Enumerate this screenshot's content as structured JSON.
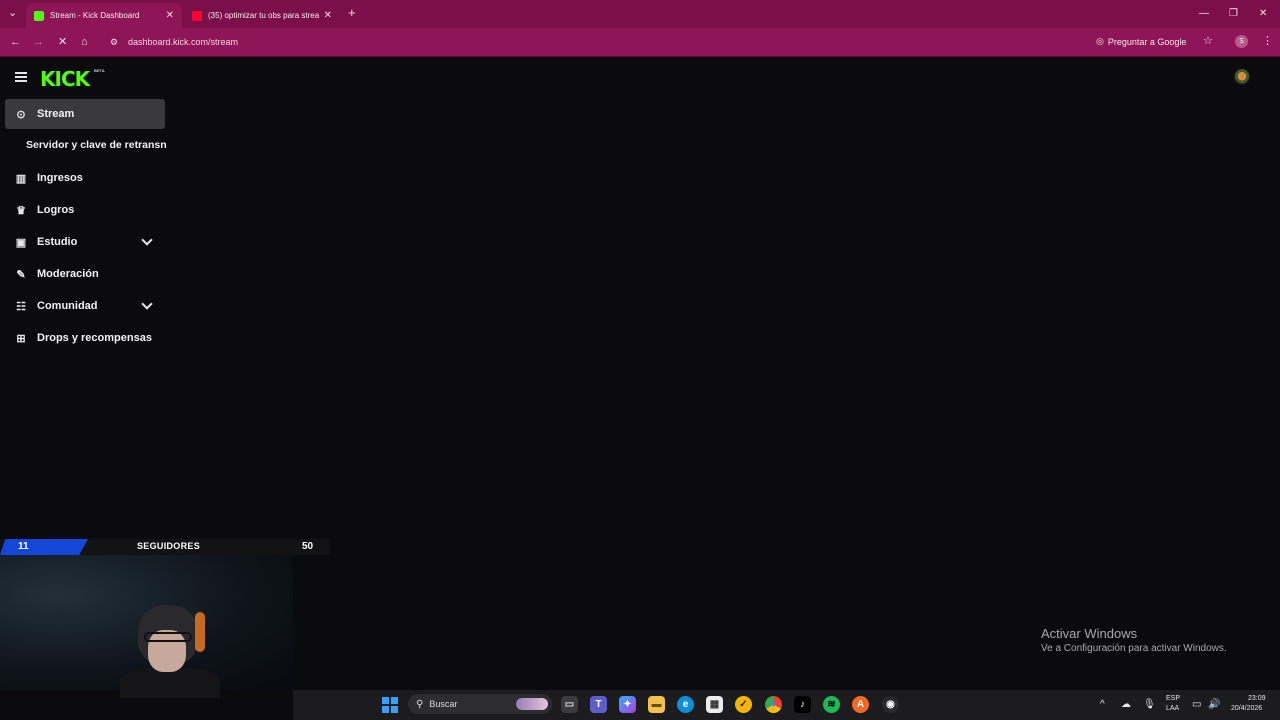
{
  "browser": {
    "tabs": [
      {
        "title": "Stream - Kick Dashboard",
        "favicon_color": "#53fc18",
        "active": true
      },
      {
        "title": "(35) optimizar tu obs para strea",
        "favicon_color": "#ff0033",
        "active": false
      }
    ],
    "new_tab_label": "+",
    "url": "dashboard.kick.com/stream",
    "ask_google": "Preguntar a Google",
    "profile_initial": "S"
  },
  "kick": {
    "logo": "KICK",
    "beta": "BETA",
    "nav": [
      {
        "label": "Stream",
        "icon": "broadcast-icon",
        "active": true
      },
      {
        "label": "Ingresos",
        "icon": "chart-icon"
      },
      {
        "label": "Logros",
        "icon": "trophy-icon"
      },
      {
        "label": "Estudio",
        "icon": "studio-icon",
        "expandable": true
      },
      {
        "label": "Moderación",
        "icon": "wrench-icon"
      },
      {
        "label": "Comunidad",
        "icon": "people-icon",
        "expandable": true
      },
      {
        "label": "Drops y recompensas",
        "icon": "drops-icon"
      }
    ],
    "sub_item": "Servidor y clave de retransn"
  },
  "overlay": {
    "followers_current": "11",
    "followers_label": "SEGUIDORES",
    "followers_goal": "50"
  },
  "watermark": {
    "title": "Activar Windows",
    "subtitle": "Ve a Configuración para activar Windows."
  },
  "taskbar": {
    "search_label": "Buscar",
    "language": "ESP",
    "layout": "LAA",
    "time": "23:09",
    "date": "20/4/2026"
  },
  "colors": {
    "kick_green": "#53fc18",
    "chrome_tab": "#7a0f4a",
    "chrome_bar": "#8d1558",
    "page_bg": "#0b0b0d"
  }
}
